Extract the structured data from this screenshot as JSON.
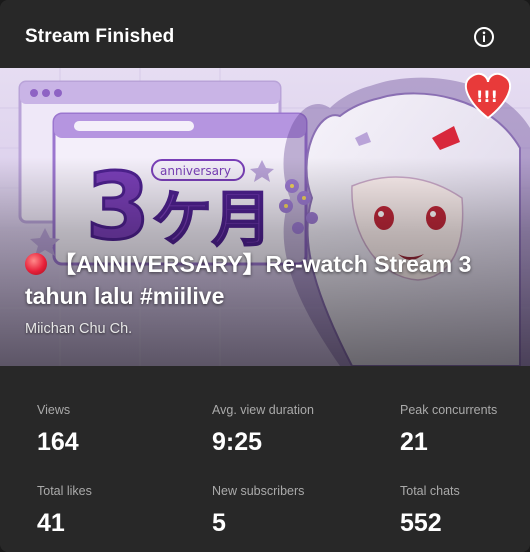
{
  "header": {
    "title": "Stream Finished",
    "info_icon": "info-icon"
  },
  "hero": {
    "thumbnail_text_big": "3ヶ月",
    "thumbnail_text_small": "anniversary",
    "badge_text": "!!!",
    "title": "【ANNIVERSARY】Re-watch Stream 3 tahun lalu #miilive",
    "channel": "Miichan Chu Ch."
  },
  "stats": [
    {
      "label": "Views",
      "value": "164"
    },
    {
      "label": "Avg. view duration",
      "value": "9:25"
    },
    {
      "label": "Peak concurrents",
      "value": "21"
    },
    {
      "label": "Total likes",
      "value": "41"
    },
    {
      "label": "New subscribers",
      "value": "5"
    },
    {
      "label": "Total chats",
      "value": "552"
    }
  ],
  "colors": {
    "card_bg": "#282828",
    "accent_purple": "#7a3fb8",
    "live_dot": "#e8203a",
    "badge_red": "#e83a3a"
  }
}
